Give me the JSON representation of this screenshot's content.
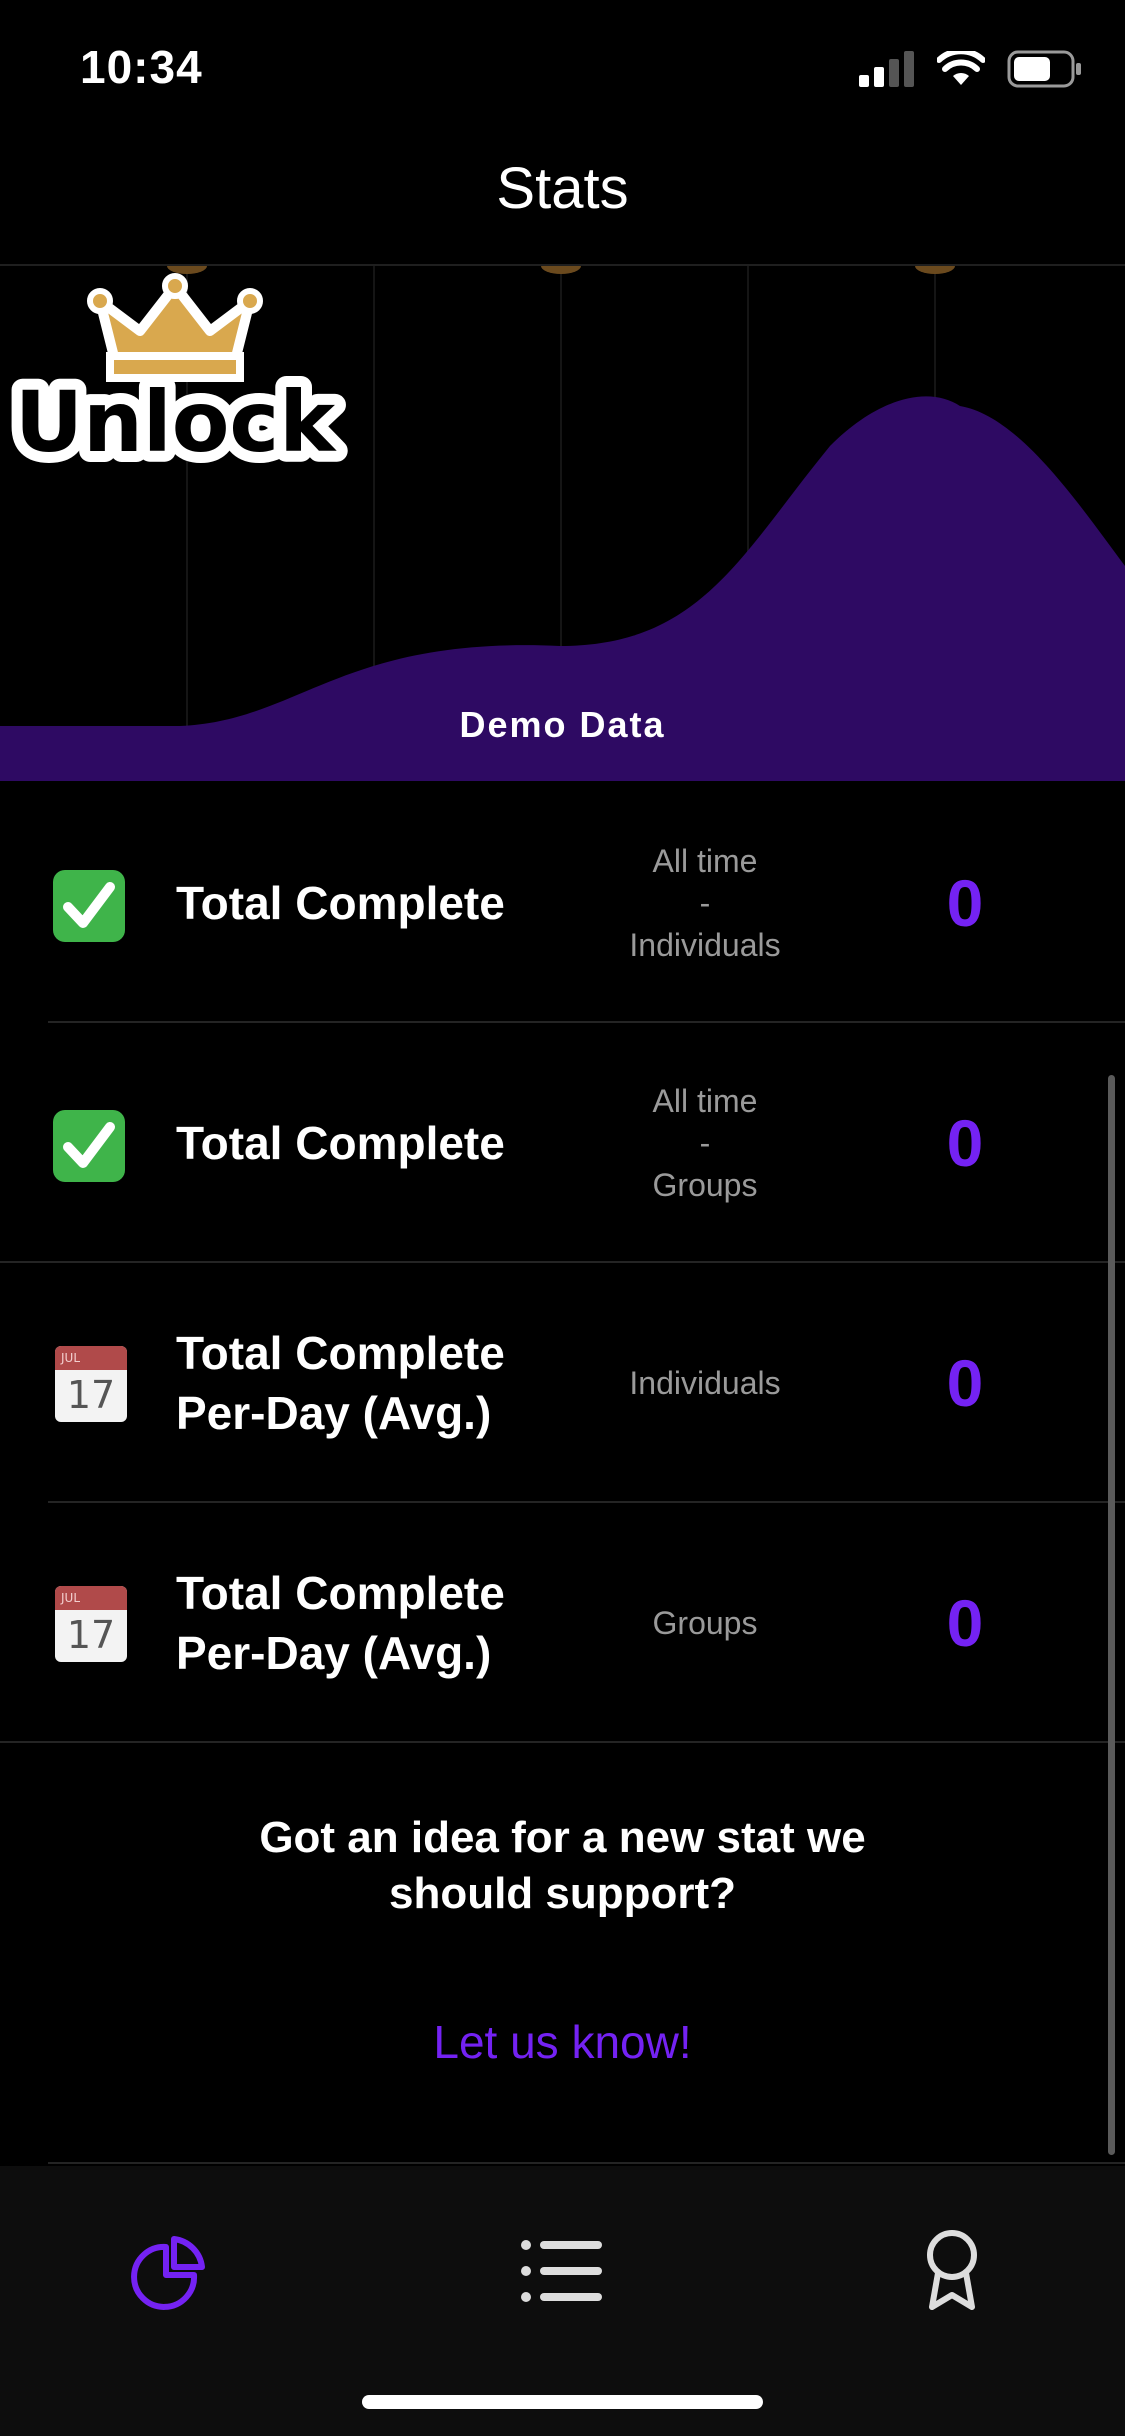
{
  "status_bar": {
    "time": "10:34"
  },
  "nav": {
    "title": "Stats"
  },
  "hero": {
    "logo_text": "Unlock",
    "caption": "Demo Data"
  },
  "stats": [
    {
      "icon": "check-mark-icon",
      "title": "Total Complete",
      "scope": [
        "All time",
        "-",
        "Individuals"
      ],
      "value": "0"
    },
    {
      "icon": "check-mark-icon",
      "title": "Total Complete",
      "scope": [
        "All time",
        "-",
        "Groups"
      ],
      "value": "0"
    },
    {
      "icon": "calendar-icon",
      "title": "Total Complete Per-Day (Avg.)",
      "scope": [
        "Individuals"
      ],
      "value": "0",
      "calendar": {
        "month": "JUL",
        "day": "17"
      }
    },
    {
      "icon": "calendar-icon",
      "title": "Total Complete Per-Day (Avg.)",
      "scope": [
        "Groups"
      ],
      "value": "0",
      "calendar": {
        "month": "JUL",
        "day": "17"
      }
    }
  ],
  "suggestion": {
    "prompt": "Got an idea for a new stat we should support?",
    "link": "Let us know!"
  },
  "tab_bar": {
    "tabs": [
      "stats-pie-icon",
      "list-icon",
      "award-icon"
    ],
    "active": "stats-pie-icon"
  },
  "colors": {
    "accent": "#7422f3",
    "hero_wave": "#2e0a63",
    "crown": "#d9a84e"
  }
}
